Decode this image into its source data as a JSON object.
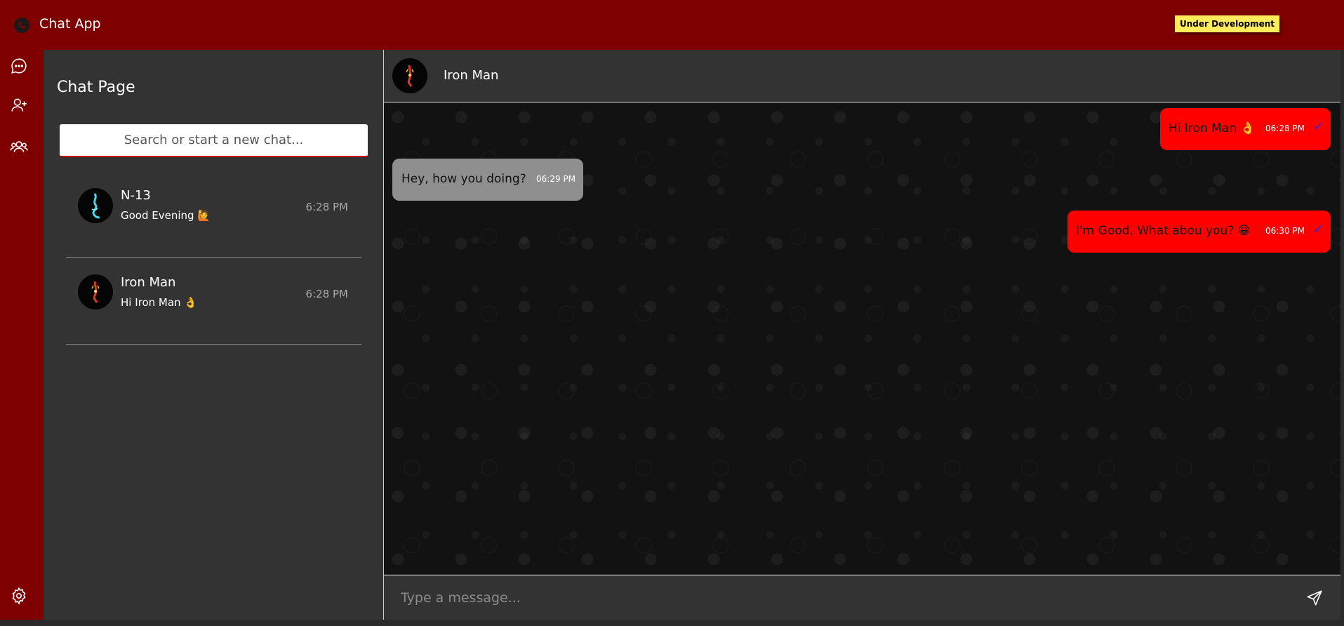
{
  "app": {
    "title": "Chat App",
    "status_badge": "Under Development"
  },
  "rail": {
    "items": [
      "chats-icon",
      "add-contact-icon",
      "groups-icon",
      "settings-icon"
    ]
  },
  "sidebar": {
    "title": "Chat Page",
    "search_placeholder": "Search or start a new chat...",
    "chats": [
      {
        "name": "N-13",
        "preview": "Good Evening 🙋",
        "time": "6:28 PM"
      },
      {
        "name": "Iron Man",
        "preview": "Hi Iron Man 👌",
        "time": "6:28 PM"
      }
    ]
  },
  "conversation": {
    "contact_name": "Iron Man",
    "messages": [
      {
        "direction": "outgoing",
        "text": "Hi Iron Man 👌",
        "time": "06:28 PM",
        "status": "✓"
      },
      {
        "direction": "incoming",
        "text": "Hey, how you doing?",
        "time": "06:29 PM"
      },
      {
        "direction": "outgoing",
        "text": "I'm Good, What abou you? 😁",
        "time": "06:30 PM",
        "status": "✓"
      }
    ]
  },
  "composer": {
    "placeholder": "Type a message..."
  },
  "colors": {
    "brand": "#7f0000",
    "outgoing_bubble": "#ff0000",
    "incoming_bubble": "#8f8f8f",
    "badge": "#ffec5c"
  }
}
